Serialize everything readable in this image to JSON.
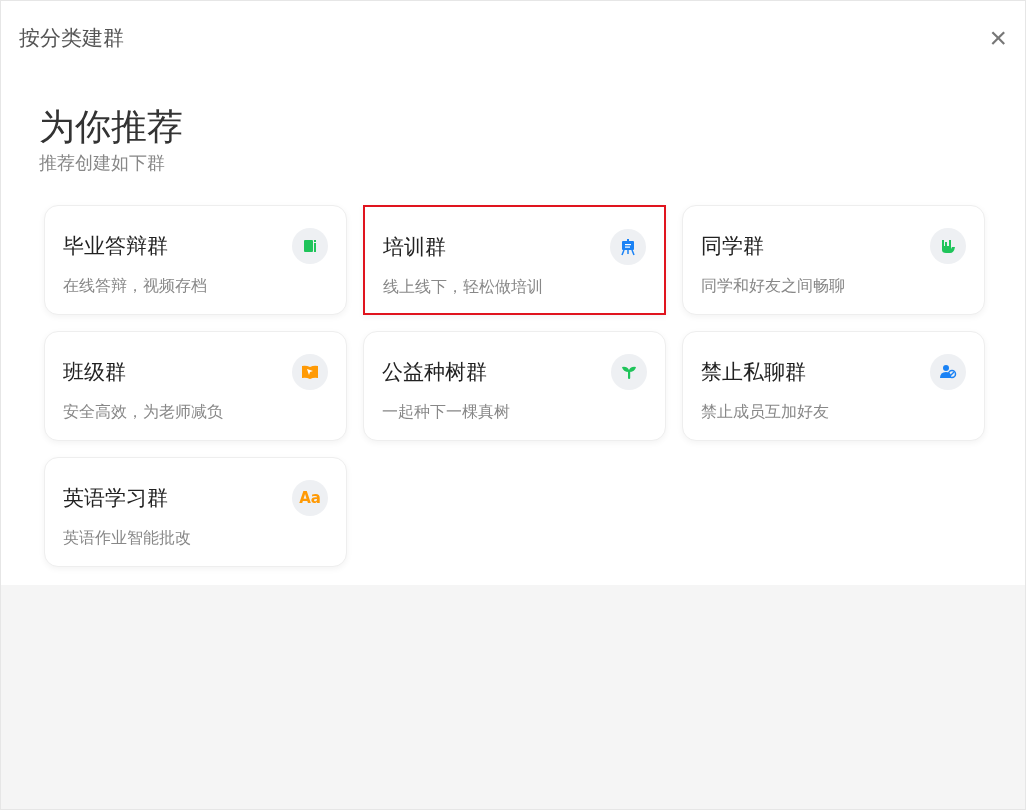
{
  "dialog": {
    "title": "按分类建群",
    "close_icon": "×"
  },
  "section": {
    "heading": "为你推荐",
    "subheading": "推荐创建如下群"
  },
  "cards": [
    {
      "title": "毕业答辩群",
      "description": "在线答辩，视频存档",
      "kind": "notebook",
      "color": "#1fc45a",
      "highlighted": false
    },
    {
      "title": "培训群",
      "description": "线上线下，轻松做培训",
      "kind": "easel",
      "color": "#1a82f5",
      "highlighted": true
    },
    {
      "title": "同学群",
      "description": "同学和好友之间畅聊",
      "kind": "hand",
      "color": "#1fc45a",
      "highlighted": false
    },
    {
      "title": "班级群",
      "description": "安全高效，为老师减负",
      "kind": "book",
      "color": "#ff9a05",
      "highlighted": false
    },
    {
      "title": "公益种树群",
      "description": "一起种下一棵真树",
      "kind": "sprout",
      "color": "#1fc45a",
      "highlighted": false
    },
    {
      "title": "禁止私聊群",
      "description": "禁止成员互加好友",
      "kind": "people",
      "color": "#1a82f5",
      "highlighted": false
    },
    {
      "title": "英语学习群",
      "description": "英语作业智能批改",
      "kind": "text",
      "color": "#ff9a05",
      "highlighted": false,
      "icon_text": "Aa"
    }
  ]
}
